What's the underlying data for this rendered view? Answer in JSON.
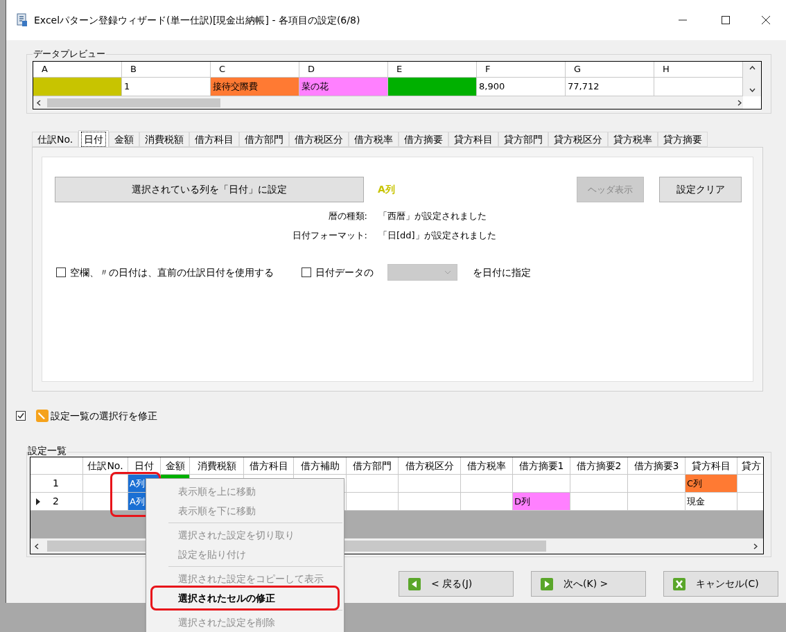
{
  "window": {
    "title": "Excelパターン登録ウィザード(単一仕訳)[現金出納帳] - 各項目の設定(6/8)"
  },
  "data_preview": {
    "title": "データプレビュー",
    "columns": [
      "A",
      "B",
      "C",
      "D",
      "E",
      "F",
      "G",
      "H"
    ],
    "cells": [
      {
        "color": "#c8c400"
      },
      {
        "text": "1"
      },
      {
        "text": "接待交際費",
        "color": "#ff7a33"
      },
      {
        "text": "菜の花",
        "color": "#ff80ff"
      },
      {
        "color": "#00b000"
      },
      {
        "text": "8,900"
      },
      {
        "text": "77,712"
      },
      {}
    ]
  },
  "tabs": [
    {
      "label": "仕訳No.",
      "selected": false
    },
    {
      "label": "日付",
      "selected": true
    },
    {
      "label": "金額",
      "selected": false
    },
    {
      "label": "消費税額",
      "selected": false
    },
    {
      "label": "借方科目",
      "selected": false
    },
    {
      "label": "借方部門",
      "selected": false
    },
    {
      "label": "借方税区分",
      "selected": false
    },
    {
      "label": "借方税率",
      "selected": false
    },
    {
      "label": "借方摘要",
      "selected": false
    },
    {
      "label": "貸方科目",
      "selected": false
    },
    {
      "label": "貸方部門",
      "selected": false
    },
    {
      "label": "貸方税区分",
      "selected": false
    },
    {
      "label": "貸方税率",
      "selected": false
    },
    {
      "label": "貸方摘要",
      "selected": false
    }
  ],
  "date_settings": {
    "assign_button": "選択されている列を「日付」に設定",
    "assigned_column": "A列",
    "header_button": {
      "label": "ヘッダ表示",
      "disabled": true
    },
    "clear_button": {
      "label": "設定クリア",
      "disabled": false
    },
    "info": [
      {
        "label": "暦の種類:",
        "value": "「西暦」が設定されました"
      },
      {
        "label": "日付フォーマット:",
        "value": "「日[dd]」が設定されました"
      }
    ],
    "blank_option": {
      "label": "空欄、〃の日付は、直前の仕訳日付を使用する",
      "checked": false
    },
    "data_option": {
      "label": "日付データの",
      "checked": false,
      "dropdown_disabled": true,
      "suffix": "を日付に指定"
    }
  },
  "edit_selected": {
    "label": "設定一覧の選択行を修正",
    "checked": true
  },
  "settings_list": {
    "title": "設定一覧",
    "columns": [
      "仕訳No.",
      "日付",
      "金額",
      "消費税額",
      "借方科目",
      "借方補助",
      "借方部門",
      "借方税区分",
      "借方税率",
      "借方摘要1",
      "借方摘要2",
      "借方摘要3",
      "貸方科目",
      "貸方"
    ],
    "rows": [
      {
        "header": "1",
        "current": false,
        "cells": [
          {},
          {
            "text": "A列",
            "color": "#1a6fd4"
          },
          {
            "color": "#00b000"
          },
          {},
          {},
          {},
          {},
          {},
          {},
          {},
          {},
          {},
          {
            "text": "C列",
            "color": "#ff7a33"
          },
          {}
        ]
      },
      {
        "header": "2",
        "current": true,
        "cells": [
          {},
          {
            "text": "A列",
            "color": "#1a6fd4"
          },
          {},
          {},
          {},
          {},
          {},
          {},
          {},
          {
            "text": "D列",
            "color": "#ff80ff"
          },
          {},
          {},
          {
            "text": "現金"
          },
          {}
        ]
      }
    ]
  },
  "nav_buttons": [
    {
      "kind": "back",
      "label": "< 戻る(J)"
    },
    {
      "kind": "next",
      "label": "次へ(K) >"
    },
    {
      "kind": "cancel",
      "label": "キャンセル(C)"
    }
  ],
  "context_menu": {
    "items": [
      {
        "kind": "item",
        "label": "表示順を上に移動",
        "disabled": true
      },
      {
        "kind": "item",
        "label": "表示順を下に移動",
        "disabled": true
      },
      {
        "kind": "separator"
      },
      {
        "kind": "item",
        "label": "選択された設定を切り取り",
        "disabled": true
      },
      {
        "kind": "item",
        "label": "設定を貼り付け",
        "disabled": true
      },
      {
        "kind": "separator"
      },
      {
        "kind": "item",
        "label": "選択された設定をコピーして表示",
        "disabled": true
      },
      {
        "kind": "item",
        "label": "選択されたセルの修正",
        "disabled": false
      },
      {
        "kind": "separator"
      },
      {
        "kind": "item",
        "label": "選択された設定を削除",
        "disabled": true
      }
    ]
  }
}
